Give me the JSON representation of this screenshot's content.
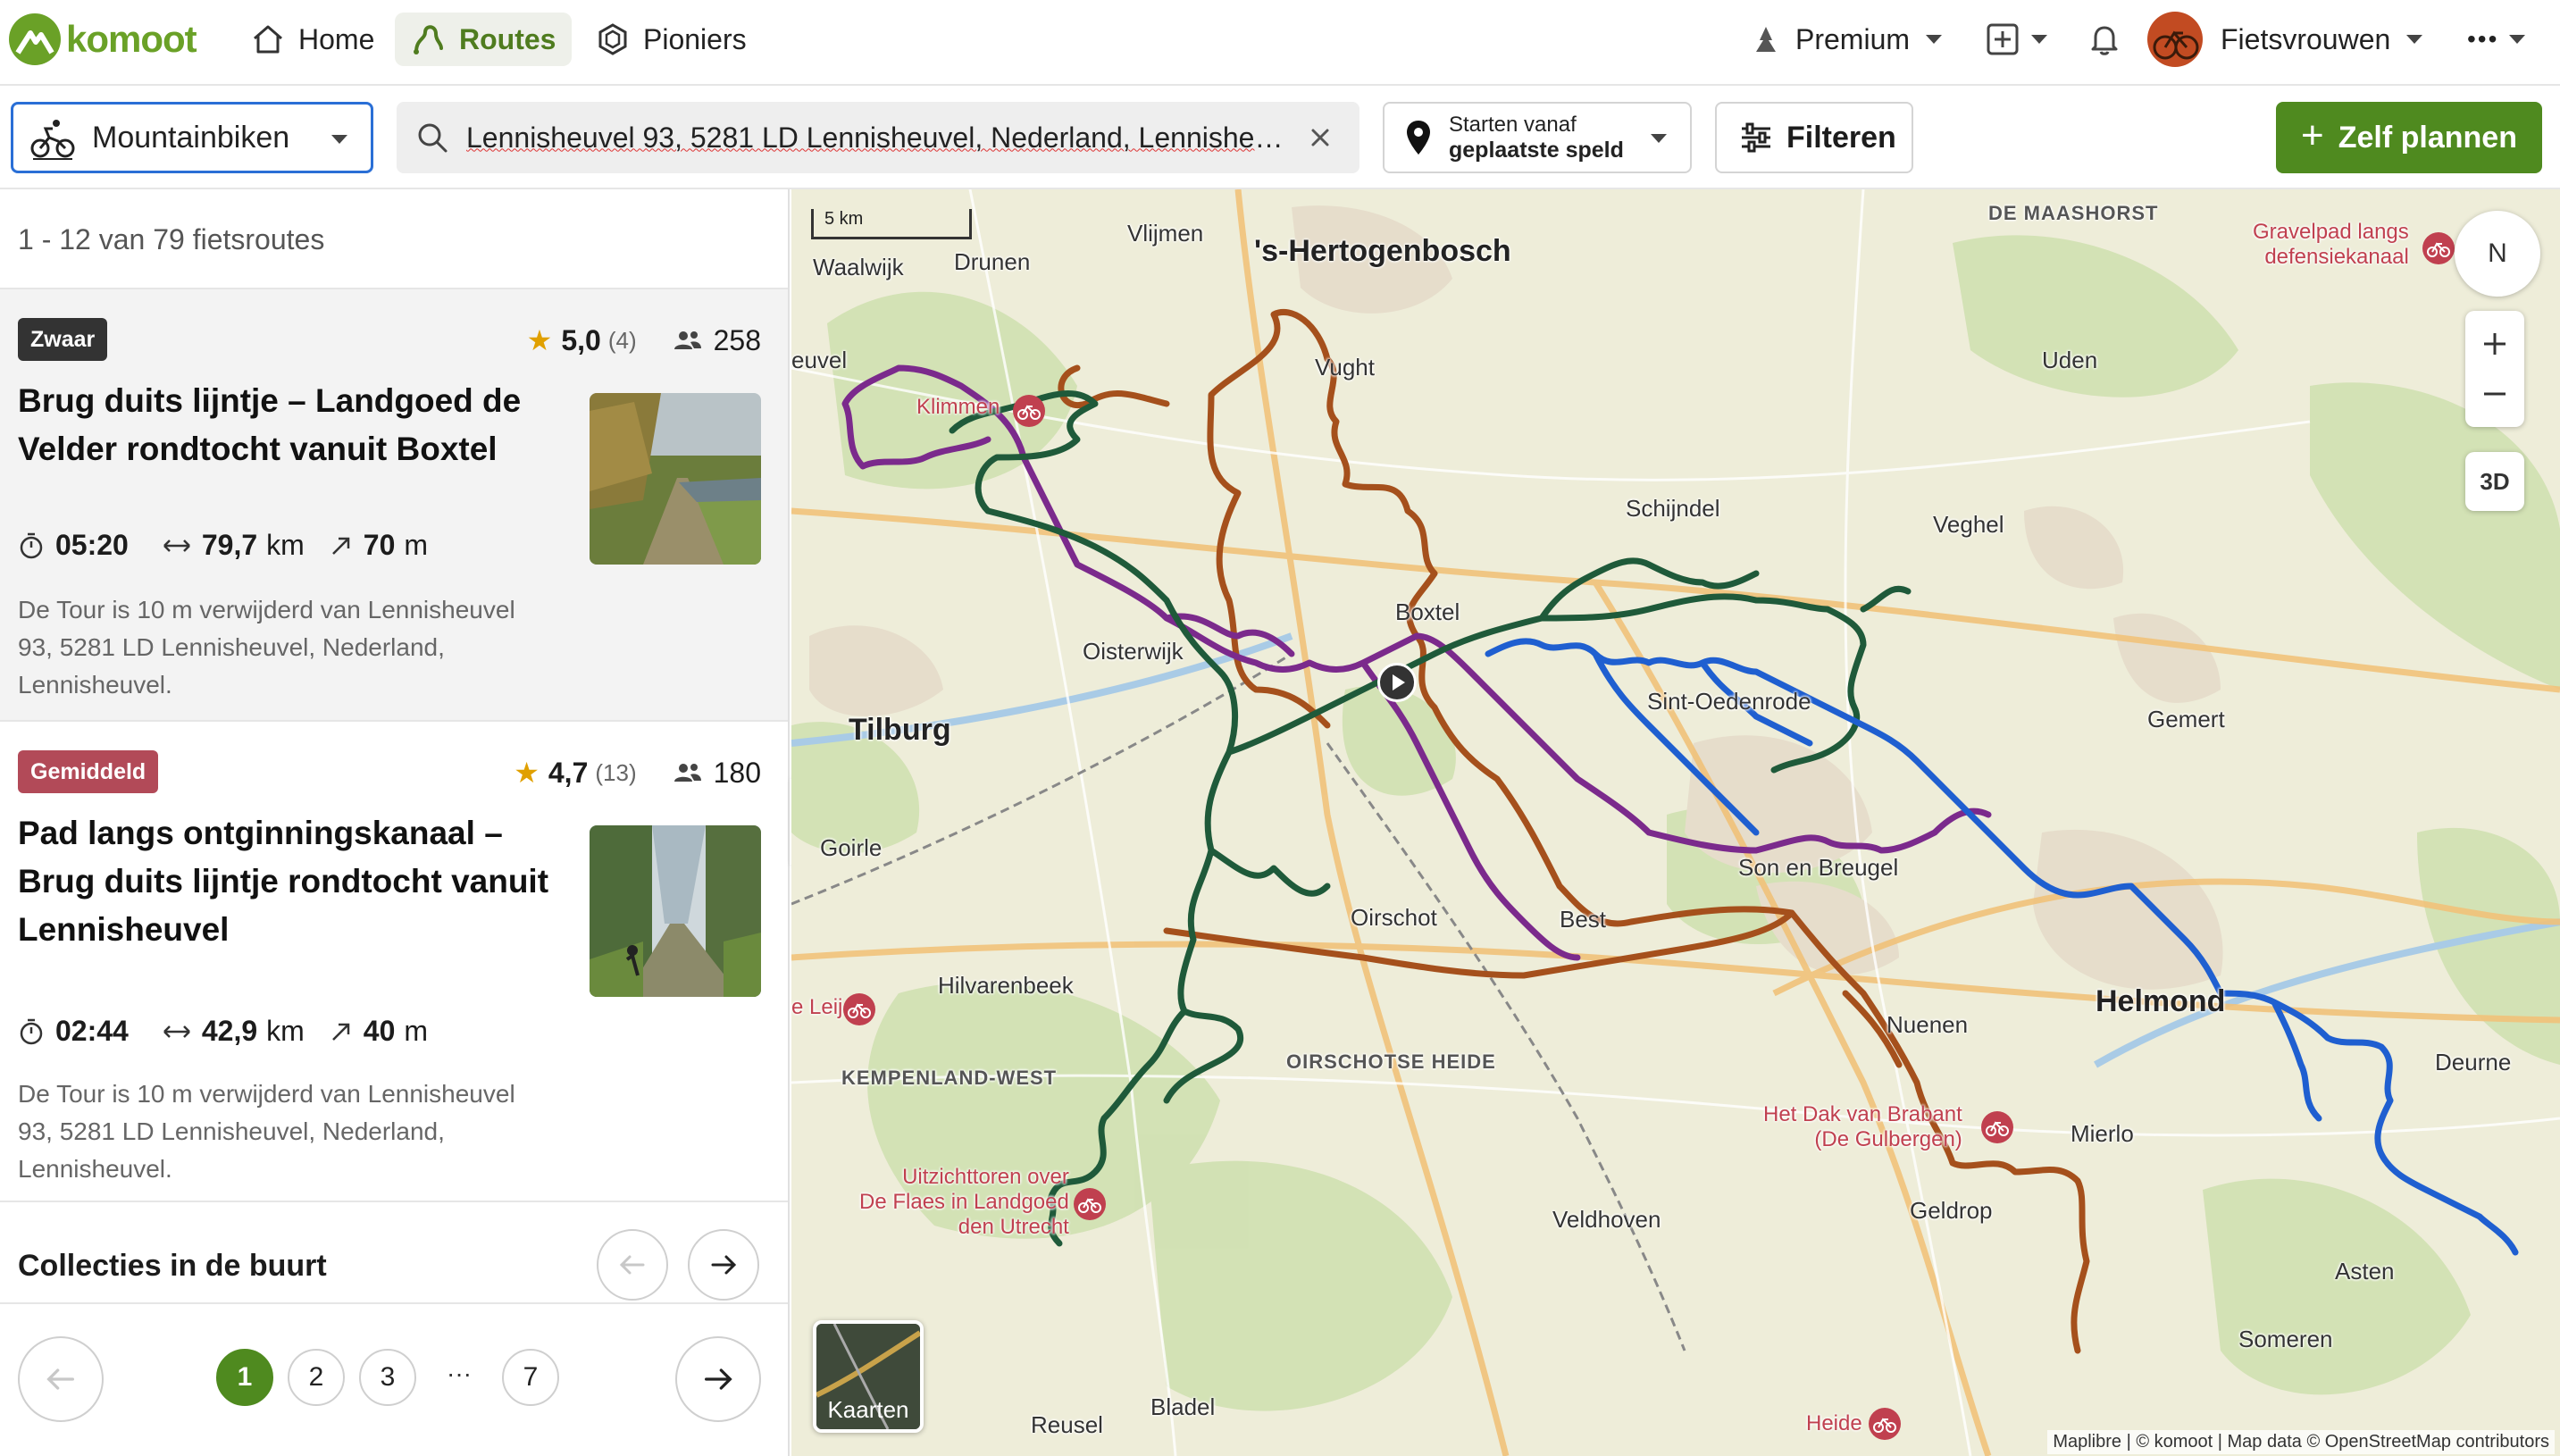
{
  "nav": {
    "logo_text": "komoot",
    "home": "Home",
    "routes": "Routes",
    "pioneers": "Pioniers",
    "premium": "Premium",
    "user": "Fietsvrouwen",
    "more": "•••"
  },
  "filters": {
    "sport": "Mountainbiken",
    "search_value": "Lennisheuvel 93, 5281 LD Lennisheuvel, Nederland, Lennisheuvel",
    "start_line1": "Starten vanaf",
    "start_line2": "geplaatste speld",
    "filter_label": "Filteren",
    "plan_label": "Zelf plannen"
  },
  "results": {
    "count_text": "1 - 12 van 79 fietsroutes",
    "routes": [
      {
        "difficulty": "Zwaar",
        "rating": "5,0",
        "rating_count": "(4)",
        "followers": "258",
        "title": "Brug duits lijntje – Landgoed de Velder rondtocht vanuit Boxtel",
        "duration": "05:20",
        "distance": "79,7",
        "distance_unit": "km",
        "elevation": "70",
        "elevation_unit": "m",
        "description": "De Tour is 10 m verwijderd van Lennisheuvel 93, 5281 LD Lennisheuvel, Nederland, Lennisheuvel."
      },
      {
        "difficulty": "Gemiddeld",
        "rating": "4,7",
        "rating_count": "(13)",
        "followers": "180",
        "title": "Pad langs ontginningskanaal – Brug duits lijntje rondtocht vanuit Lennisheuvel",
        "duration": "02:44",
        "distance": "42,9",
        "distance_unit": "km",
        "elevation": "40",
        "elevation_unit": "m",
        "description": "De Tour is 10 m verwijderd van Lennisheuvel 93, 5281 LD Lennisheuvel, Nederland, Lennisheuvel."
      }
    ],
    "collections_title": "Collecties in de buurt"
  },
  "pagination": {
    "pages": [
      "1",
      "2",
      "3",
      "7"
    ],
    "ellipsis": "···",
    "current": "1"
  },
  "map": {
    "scale": "5 km",
    "compass": "N",
    "mode_3d": "3D",
    "layers_label": "Kaarten",
    "attribution": "Maplibre | © komoot | Map data © OpenStreetMap contributors",
    "labels": {
      "den_bosch": "'s-Hertogenbosch",
      "tilburg": "Tilburg",
      "helmond": "Helmond",
      "waalwijk": "Waalwijk",
      "drunen": "Drunen",
      "vlijmen": "Vlijmen",
      "vught": "Vught",
      "uden": "Uden",
      "schijndel": "Schijndel",
      "veghel": "Veghel",
      "boxtel": "Boxtel",
      "oisterwijk": "Oisterwijk",
      "sint_oedenrode": "Sint-Oedenrode",
      "gemert": "Gemert",
      "goirle": "Goirle",
      "son": "Son en Breugel",
      "oirschot": "Oirschot",
      "best": "Best",
      "hilvarenbeek": "Hilvarenbeek",
      "nuenen": "Nuenen",
      "deurne": "Deurne",
      "mierlo": "Mierlo",
      "geldrop": "Geldrop",
      "veldhoven": "Veldhoven",
      "asten": "Asten",
      "someren": "Someren",
      "reusel": "Reusel",
      "bladel": "Bladel",
      "waalwijk_edge": "euvel",
      "de_maashorst": "DE MAASHORST",
      "kempenland": "KEMPENLAND-WEST",
      "oirschotse_heide": "OIRSCHOTSE HEIDE",
      "poi_klimmen": "Klimmen",
      "poi_gravelpad": "Gravelpad langs\ndefensiekanaal",
      "poi_leij": "e Leij",
      "poi_dak": "Het Dak van Brabant\n(De Gulbergen)",
      "poi_uitzicht": "Uitzichttoren over\nDe Flaes in Landgoed\nden Utrecht",
      "poi_heide": "Heide"
    }
  },
  "colors": {
    "brand_green": "#6aa127",
    "primary_button": "#4f8a1f",
    "route_purple": "#7b2a8c",
    "route_green": "#1f5a3a",
    "route_brown": "#a5501c",
    "route_blue": "#1f5fd0",
    "badge_hard": "#333333",
    "badge_medium": "#b24a58"
  }
}
